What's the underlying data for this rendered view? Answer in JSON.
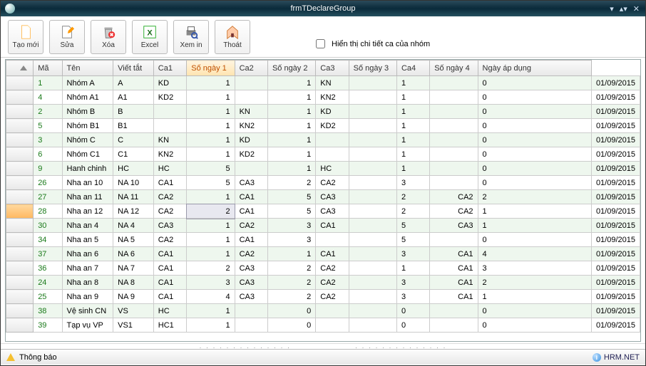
{
  "window": {
    "title": "frmTDeclareGroup"
  },
  "toolbar": {
    "buttons": [
      {
        "label": "Tạo mới",
        "icon": "file-new-icon"
      },
      {
        "label": "Sửa",
        "icon": "edit-icon"
      },
      {
        "label": "Xóa",
        "icon": "delete-icon"
      },
      {
        "label": "Excel",
        "icon": "excel-icon"
      },
      {
        "label": "Xem in",
        "icon": "print-preview-icon"
      },
      {
        "label": "Thoát",
        "icon": "exit-icon"
      }
    ],
    "checkbox_label": "Hiển thị chi tiết ca của nhóm"
  },
  "grid": {
    "sorted_column": 4,
    "selected_row": 10,
    "columns": [
      "Mã",
      "Tên",
      "Viết tắt",
      "Ca1",
      "Số ngày 1",
      "Ca2",
      "Số ngày 2",
      "Ca3",
      "Số ngày 3",
      "Ca4",
      "Số ngày 4",
      "Ngày áp dụng"
    ],
    "rows": [
      [
        "1",
        "Nhóm A",
        "A",
        "KD",
        "1",
        "",
        "1",
        "KN",
        "",
        "1",
        "",
        "0",
        "01/09/2015"
      ],
      [
        "4",
        "Nhóm A1",
        "A1",
        "KD2",
        "1",
        "",
        "1",
        "KN2",
        "",
        "1",
        "",
        "0",
        "01/09/2015"
      ],
      [
        "2",
        "Nhóm B",
        "B",
        "",
        "1",
        "KN",
        "1",
        "KD",
        "",
        "1",
        "",
        "0",
        "01/09/2015"
      ],
      [
        "5",
        "Nhóm B1",
        "B1",
        "",
        "1",
        "KN2",
        "1",
        "KD2",
        "",
        "1",
        "",
        "0",
        "01/09/2015"
      ],
      [
        "3",
        "Nhóm C",
        "C",
        "KN",
        "1",
        "KD",
        "1",
        "",
        "",
        "1",
        "",
        "0",
        "01/09/2015"
      ],
      [
        "6",
        "Nhóm C1",
        "C1",
        "KN2",
        "1",
        "KD2",
        "1",
        "",
        "",
        "1",
        "",
        "0",
        "01/09/2015"
      ],
      [
        "9",
        "Hanh chinh",
        "HC",
        "HC",
        "5",
        "",
        "1",
        "HC",
        "",
        "1",
        "",
        "0",
        "01/09/2015"
      ],
      [
        "26",
        "Nha an 10",
        "NA 10",
        "CA1",
        "5",
        "CA3",
        "2",
        "CA2",
        "",
        "3",
        "",
        "0",
        "01/09/2015"
      ],
      [
        "27",
        "Nha an 11",
        "NA 11",
        "CA2",
        "1",
        "CA1",
        "5",
        "CA3",
        "",
        "2",
        "CA2",
        "2",
        "01/09/2015"
      ],
      [
        "28",
        "Nha an 12",
        "NA 12",
        "CA2",
        "2",
        "CA1",
        "5",
        "CA3",
        "",
        "2",
        "CA2",
        "1",
        "01/09/2015"
      ],
      [
        "30",
        "Nha an 4",
        "NA 4",
        "CA3",
        "1",
        "CA2",
        "3",
        "CA1",
        "",
        "5",
        "CA3",
        "1",
        "01/09/2015"
      ],
      [
        "34",
        "Nha an 5",
        "NA 5",
        "CA2",
        "1",
        "CA1",
        "3",
        "",
        "",
        "5",
        "",
        "0",
        "01/09/2015"
      ],
      [
        "37",
        "Nha an 6",
        "NA 6",
        "CA1",
        "1",
        "CA2",
        "1",
        "CA1",
        "",
        "3",
        "CA1",
        "4",
        "01/09/2015"
      ],
      [
        "36",
        "Nha an 7",
        "NA 7",
        "CA1",
        "2",
        "CA3",
        "2",
        "CA2",
        "",
        "1",
        "CA1",
        "3",
        "01/09/2015"
      ],
      [
        "24",
        "Nha an 8",
        "NA 8",
        "CA1",
        "3",
        "CA3",
        "2",
        "CA2",
        "",
        "3",
        "CA1",
        "2",
        "01/09/2015"
      ],
      [
        "25",
        "Nha an 9",
        "NA 9",
        "CA1",
        "4",
        "CA3",
        "2",
        "CA2",
        "",
        "3",
        "CA1",
        "1",
        "01/09/2015"
      ],
      [
        "38",
        "Vệ sinh CN",
        "VS",
        "HC",
        "1",
        "",
        "0",
        "",
        "",
        "0",
        "",
        "0",
        "01/09/2015"
      ],
      [
        "39",
        "Tạp vụ VP",
        "VS1",
        "HC1",
        "1",
        "",
        "0",
        "",
        "",
        "0",
        "",
        "0",
        "01/09/2015"
      ]
    ]
  },
  "statusbar": {
    "left": "Thông báo",
    "right": "HRM.NET"
  }
}
